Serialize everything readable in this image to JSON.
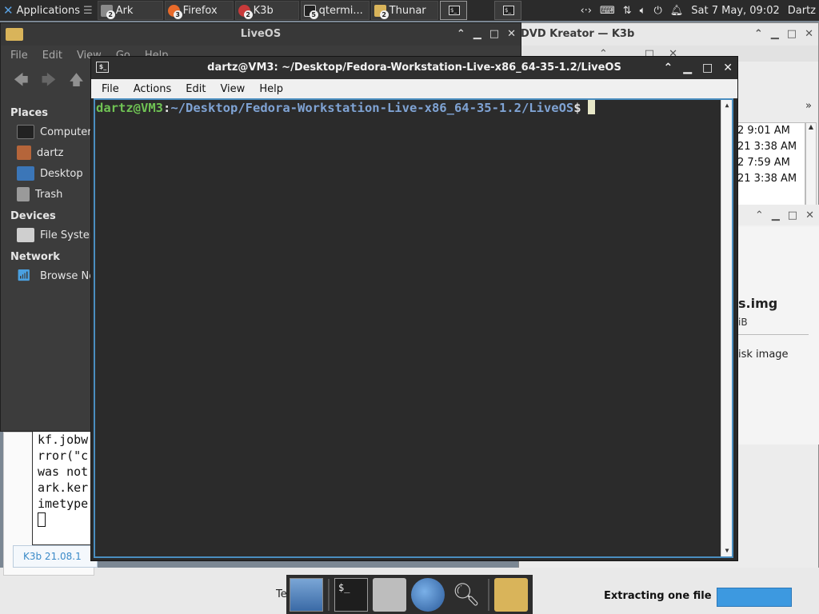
{
  "panel": {
    "applications_label": "Applications",
    "tasks": [
      {
        "label": "Ark",
        "count": "2"
      },
      {
        "label": "Firefox",
        "count": "3"
      },
      {
        "label": "K3b",
        "count": "2"
      },
      {
        "label": "qtermi...",
        "count": "5"
      },
      {
        "label": "Thunar",
        "count": "2"
      }
    ],
    "clock": "Sat  7 May, 09:02",
    "user": "Dartz"
  },
  "thunar": {
    "title": "LiveOS",
    "menu": [
      "File",
      "Edit",
      "View",
      "Go",
      "Help"
    ],
    "sidebar": {
      "places_label": "Places",
      "places": [
        "Computer",
        "dartz",
        "Desktop",
        "Trash"
      ],
      "devices_label": "Devices",
      "devices": [
        "File System"
      ],
      "network_label": "Network",
      "network": [
        "Browse Network"
      ]
    }
  },
  "k3b": {
    "title": "DVD Kreator — K3b",
    "times": [
      "2 9:01 AM",
      "21 3:38 AM",
      "2 7:59 AM",
      "21 3:38 AM"
    ],
    "version": "K3b 21.08.1"
  },
  "ark": {
    "filename": "s.img",
    "size_fragment": "iB",
    "type_fragment": "isk image",
    "extract_label": "Extracting one file"
  },
  "console": {
    "lines": [
      "kf.jobw",
      "rror(\"c",
      "was not",
      "ark.ker",
      "imetype"
    ]
  },
  "terminal": {
    "title": "dartz@VM3: ~/Desktop/Fedora-Workstation-Live-x86_64-35-1.2/LiveOS",
    "menu": [
      "File",
      "Actions",
      "Edit",
      "View",
      "Help"
    ],
    "prompt_user": "dartz@VM3",
    "prompt_sep": ":",
    "prompt_path": "~/Desktop/Fedora-Workstation-Live-x86_64-35-1.2/LiveOS",
    "prompt_sign": "$"
  },
  "bottom": {
    "te_fragment": "Te"
  }
}
